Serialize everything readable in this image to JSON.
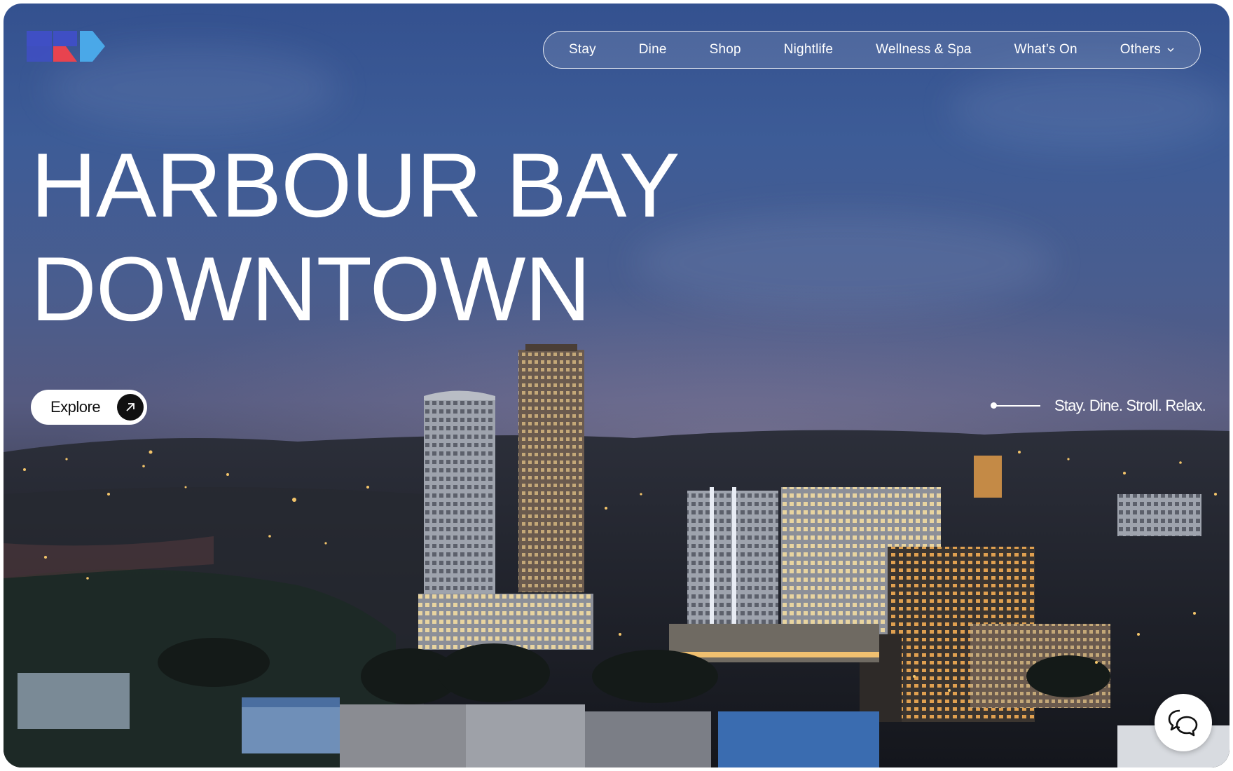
{
  "brand": {
    "logo_icon": "hbd-logo-icon",
    "colors": {
      "blue": "#3f4fc4",
      "red": "#e8434f",
      "light_blue": "#4aa8e8"
    }
  },
  "nav": {
    "items": [
      {
        "label": "Stay"
      },
      {
        "label": "Dine"
      },
      {
        "label": "Shop"
      },
      {
        "label": "Nightlife"
      },
      {
        "label": "Wellness & Spa"
      },
      {
        "label": "What’s On"
      },
      {
        "label": "Others",
        "icon": "chevron-down-icon"
      }
    ]
  },
  "hero": {
    "line1": "HARBOUR BAY",
    "line2": "DOWNTOWN"
  },
  "cta": {
    "label": "Explore",
    "icon": "arrow-up-right-icon"
  },
  "tagline": "Stay. Dine. Stroll. Relax.",
  "chat": {
    "icon": "chat-bubbles-icon"
  }
}
